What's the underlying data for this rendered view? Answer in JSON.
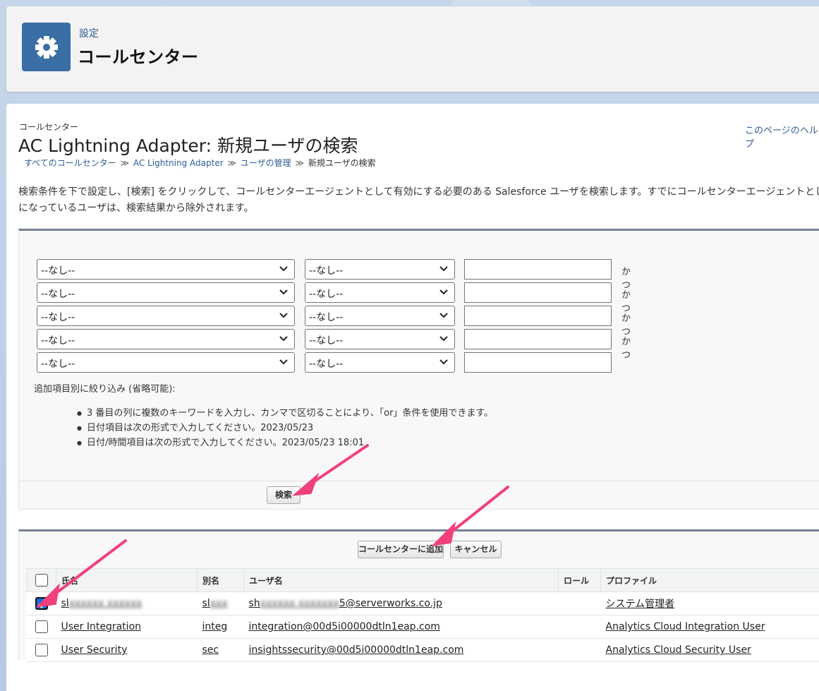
{
  "header": {
    "breadcrumb": "設定",
    "title": "コールセンター"
  },
  "page": {
    "type_label": "コールセンター",
    "title": "AC Lightning Adapter: 新規ユーザの検索",
    "help_link": "このページのヘルプ",
    "breadcrumb": {
      "item1": "すべてのコールセンター",
      "item2": "AC Lightning Adapter",
      "item3": "ユーザの管理",
      "current": "新規ユーザの検索",
      "separator": "≫"
    },
    "description_line1": "検索条件を下で設定し、[検索] をクリックして、コールセンターエージェントとして有効にする必要のある Salesforce ユーザを検索します。すでにコールセンターエージェントとして有",
    "description_line2": "になっているユーザは、検索結果から除外されます。"
  },
  "filters": {
    "field_value": "--なし--",
    "operator_value": "--なし--",
    "and_label": "かつ",
    "hint_title": "追加項目別に絞り込み (省略可能):",
    "hints": [
      "3 番目の列に複数のキーワードを入力し、カンマで区切ることにより、「or」条件を使用できます。",
      "日付項目は次の形式で入力してください。2023/05/23",
      "日付/時間項目は次の形式で入力してください。2023/05/23 18:01"
    ],
    "search_button": "検索"
  },
  "results": {
    "add_button": "コールセンターに追加",
    "cancel_button": "キャンセル",
    "columns": {
      "name": "氏名",
      "alias": "別名",
      "username": "ユーザ名",
      "role": "ロール",
      "profile": "プロファイル"
    },
    "rows": [
      {
        "checked": true,
        "name_visible": "sl",
        "name_blurred": "xxxxxx xxxxxx",
        "alias_visible": "sl",
        "alias_blurred": "xxx",
        "username_prefix": "sh",
        "username_blurred": "xxxxxx xxxxxxx",
        "username_suffix": "5@serverworks.co.jp",
        "role": "",
        "profile": "システム管理者"
      },
      {
        "checked": false,
        "name": "User Integration",
        "alias": "integ",
        "username": "integration@00d5i00000dtln1eap.com",
        "role": "",
        "profile": "Analytics Cloud Integration User"
      },
      {
        "checked": false,
        "name": "User Security",
        "alias": "sec",
        "username": "insightssecurity@00d5i00000dtln1eap.com",
        "role": "",
        "profile": "Analytics Cloud Security User"
      }
    ]
  },
  "colors": {
    "brand_blue": "#3a6ea5",
    "link": "#2e5d94",
    "annotation_arrow": "#f0417a",
    "checkbox_checked": "#1a6be0"
  },
  "icons": {
    "header": "gear-icon",
    "select": "chevron-down-icon"
  }
}
